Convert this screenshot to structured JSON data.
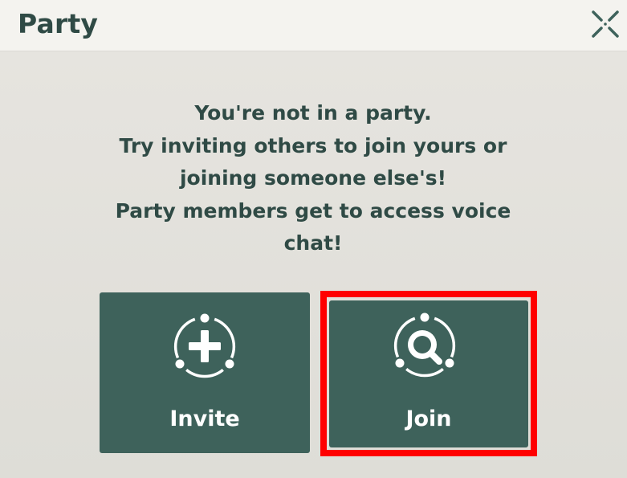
{
  "header": {
    "title": "Party",
    "close_icon": "close-x-icon"
  },
  "message": {
    "lines": [
      "You're not in a party.",
      "Try inviting others to join yours or",
      "joining someone else's!",
      "Party members get to access voice",
      "chat!"
    ]
  },
  "actions": {
    "invite": {
      "label": "Invite",
      "icon": "invite-plus-icon"
    },
    "join": {
      "label": "Join",
      "icon": "join-search-icon",
      "highlighted": true
    }
  },
  "colors": {
    "accent": "#3e625b",
    "text": "#2f4a45",
    "highlight": "#ff0000",
    "background": "#e3e1dc",
    "header_bg": "#f4f3ef"
  }
}
